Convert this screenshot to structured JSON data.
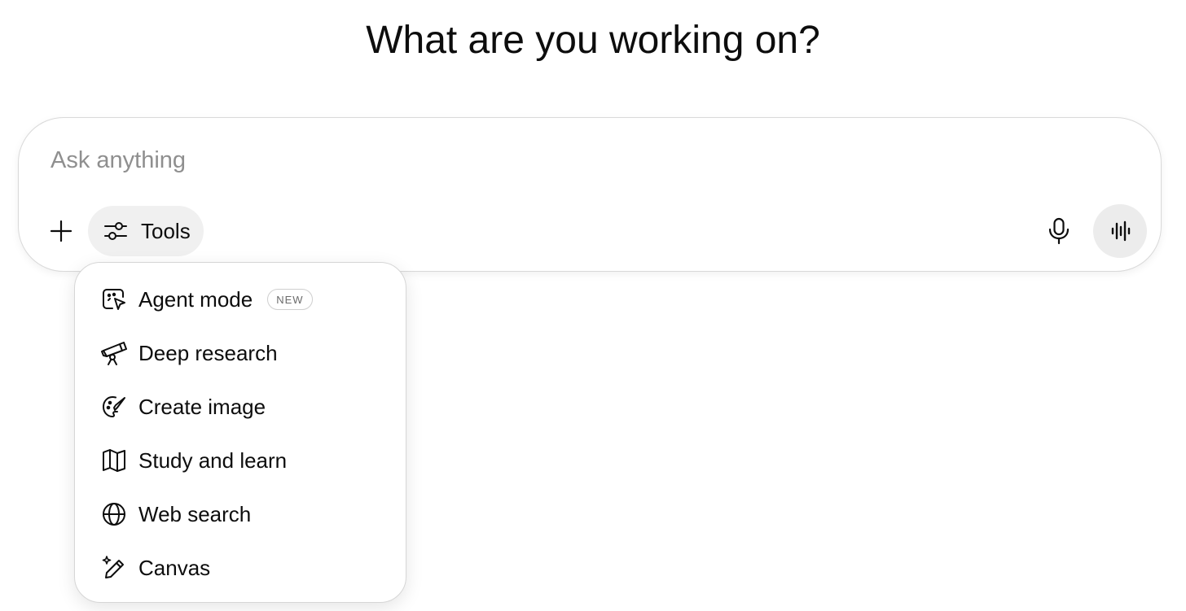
{
  "heading": "What are you working on?",
  "composer": {
    "placeholder": "Ask anything",
    "value": "",
    "tools_label": "Tools"
  },
  "tools_menu": {
    "items": [
      {
        "label": "Agent mode",
        "icon": "agent-cursor-icon",
        "badge": "NEW"
      },
      {
        "label": "Deep research",
        "icon": "telescope-icon"
      },
      {
        "label": "Create image",
        "icon": "palette-brush-icon"
      },
      {
        "label": "Study and learn",
        "icon": "open-book-icon"
      },
      {
        "label": "Web search",
        "icon": "globe-icon"
      },
      {
        "label": "Canvas",
        "icon": "pencil-sparkle-icon"
      }
    ]
  },
  "icons": {
    "plus": "plus-icon",
    "tools": "sliders-icon",
    "mic": "microphone-icon",
    "voice": "voice-waveform-icon"
  },
  "colors": {
    "text": "#0d0d0d",
    "placeholder": "#8f8f8f",
    "pill_bg": "#f0f0f0",
    "voice_bg": "#ececec",
    "border": "#d9d9d9"
  }
}
